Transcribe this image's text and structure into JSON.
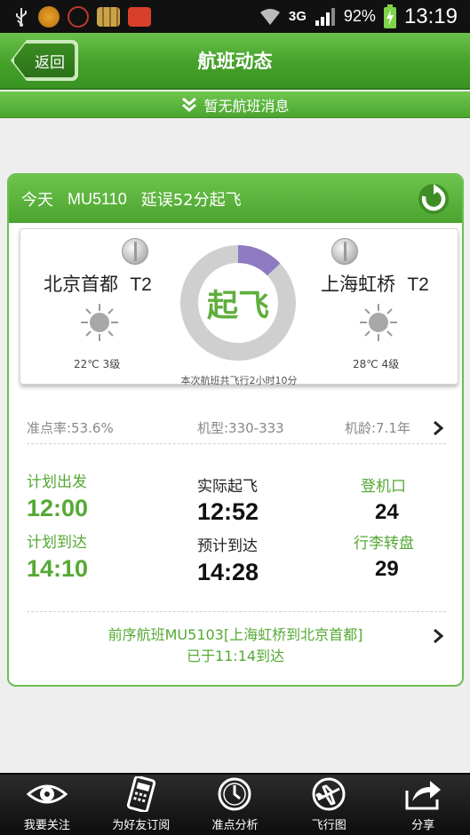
{
  "status_bar": {
    "network": "3G",
    "battery": "92%",
    "time": "13:19"
  },
  "header": {
    "back_label": "返回",
    "title": "航班动态"
  },
  "message_bar": {
    "text": "暂无航班消息"
  },
  "flight": {
    "day": "今天",
    "number": "MU5110",
    "status": "延误52分起飞",
    "departure": {
      "city": "北京首都",
      "terminal": "T2",
      "weather": "22℃  3级"
    },
    "arrival": {
      "city": "上海虹桥",
      "terminal": "T2",
      "weather": "28℃  4级"
    },
    "phase_label": "起飞",
    "progress": 0.13,
    "duration_text": "本次航班共飞行2小时10分",
    "on_time_rate": "准点率:53.6%",
    "aircraft_type": "机型:330-333",
    "aircraft_age": "机龄:7.1年",
    "planned_departure_label": "计划出发",
    "planned_departure": "12:00",
    "planned_arrival_label": "计划到达",
    "planned_arrival": "14:10",
    "actual_departure_label": "实际起飞",
    "actual_departure": "12:52",
    "expected_arrival_label": "预计到达",
    "expected_arrival": "14:28",
    "gate_label": "登机口",
    "gate": "24",
    "baggage_label": "行李转盘",
    "baggage": "29",
    "previous_flight_line1": "前序航班MU5103[上海虹桥到北京首都]",
    "previous_flight_line2": "已于11:14到达"
  },
  "bottom_nav": [
    {
      "label": "我要关注",
      "icon": "eye-icon"
    },
    {
      "label": "为好友订阅",
      "icon": "phone-icon"
    },
    {
      "label": "准点分析",
      "icon": "clock-icon"
    },
    {
      "label": "飞行图",
      "icon": "plane-icon"
    },
    {
      "label": "分享",
      "icon": "share-icon"
    }
  ],
  "colors": {
    "brand_green": "#4ba42f",
    "accent_text_green": "#55a934",
    "progress_purple": "#8e7bc2"
  }
}
